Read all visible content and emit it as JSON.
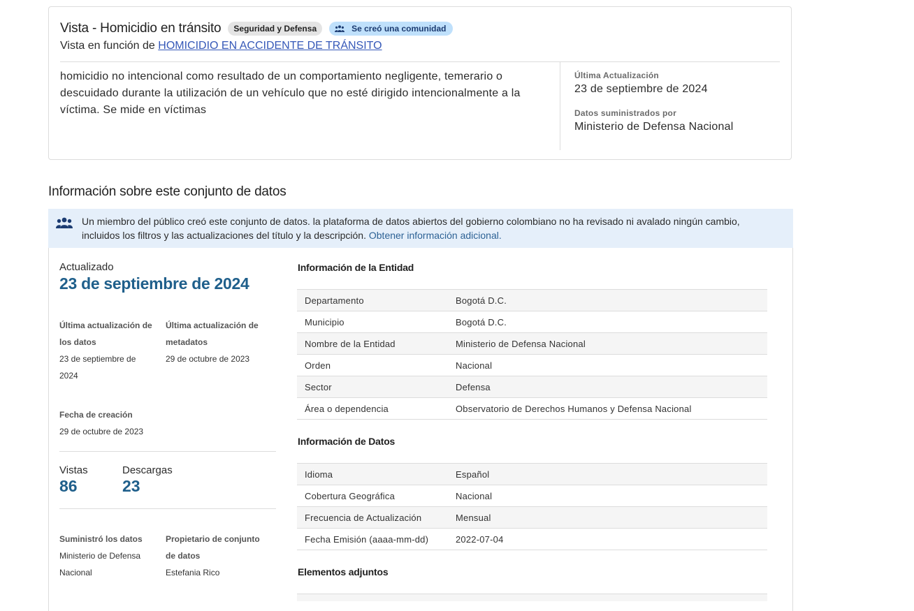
{
  "header": {
    "title": "Vista - Homicidio en tránsito",
    "category_badge": "Seguridad y Defensa",
    "community_badge": "Se creó una comunidad",
    "subtitle_prefix": "Vista en función de",
    "subtitle_link": "HOMICIDIO EN ACCIDENTE DE TRÁNSITO",
    "description": "homicidio no intencional como resultado de un comportamiento negligente, temerario o descuidado durante la utilización de un vehículo que no esté dirigido intencionalmente a la víctima. Se mide en víctimas",
    "last_update_label": "Última Actualización",
    "last_update_value": "23 de septiembre de 2024",
    "provided_by_label": "Datos suministrados por",
    "provided_by_value": "Ministerio de Defensa Nacional"
  },
  "section": {
    "title": "Información sobre este conjunto de datos",
    "notice_text": "Un miembro del público creó este conjunto de datos. la plataforma de datos abiertos del gobierno colombiano no ha revisado ni avalado ningún cambio, incluidos los filtros y las actualizaciones del título y la descripción.",
    "notice_link": "Obtener información adicional."
  },
  "left": {
    "updated_label": "Actualizado",
    "updated_value": "23 de septiembre de 2024",
    "data_update_label": "Última actualización de los datos",
    "data_update_value": "23 de septiembre de 2024",
    "metadata_update_label": "Última actualización de metadatos",
    "metadata_update_value": "29 de octubre de 2023",
    "created_label": "Fecha de creación",
    "created_value": "29 de octubre de 2023",
    "views_label": "Vistas",
    "views_value": "86",
    "downloads_label": "Descargas",
    "downloads_value": "23",
    "supplier_label": "Suministró los datos",
    "supplier_value": "Ministerio de Defensa Nacional",
    "owner_label": "Propietario de conjunto de datos",
    "owner_value": "Estefania Rico"
  },
  "entity": {
    "title": "Información de la Entidad",
    "rows": [
      {
        "k": "Departamento",
        "v": "Bogotá D.C."
      },
      {
        "k": "Municipio",
        "v": "Bogotá D.C."
      },
      {
        "k": "Nombre de la Entidad",
        "v": "Ministerio de Defensa Nacional"
      },
      {
        "k": "Orden",
        "v": "Nacional"
      },
      {
        "k": "Sector",
        "v": "Defensa"
      },
      {
        "k": "Área o dependencia",
        "v": "Observatorio de Derechos Humanos y Defensa Nacional"
      }
    ]
  },
  "datainfo": {
    "title": "Información de Datos",
    "rows": [
      {
        "k": "Idioma",
        "v": "Español"
      },
      {
        "k": "Cobertura Geográfica",
        "v": "Nacional"
      },
      {
        "k": "Frecuencia de Actualización",
        "v": "Mensual"
      },
      {
        "k": "Fecha Emisión (aaaa-mm-dd)",
        "v": "2022-07-04"
      }
    ]
  },
  "attachments": {
    "title": "Elementos adjuntos"
  },
  "icons": {
    "community": "people-group-icon"
  },
  "colors": {
    "accent": "#1f5f8b",
    "link": "#3558b8",
    "notice_bg": "#e5effa",
    "community_badge_bg": "#bfe0fb"
  }
}
